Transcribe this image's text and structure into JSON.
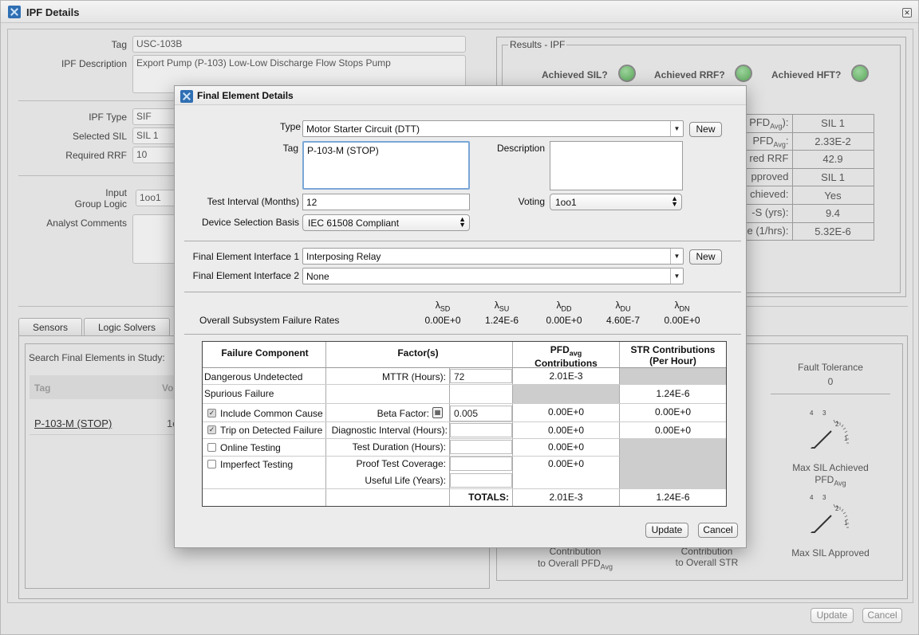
{
  "window": {
    "title": "IPF Details"
  },
  "form": {
    "tag_label": "Tag",
    "tag_value": "USC-103B",
    "desc_label": "IPF Description",
    "desc_value": "Export Pump (P-103) Low-Low Discharge Flow Stops Pump",
    "type_label": "IPF Type",
    "type_value": "SIF",
    "sil_label": "Selected SIL",
    "sil_value": "SIL 1",
    "rrf_label": "Required RRF",
    "rrf_value": "10",
    "input_label": "Input",
    "group_logic_label": "Group Logic",
    "group_logic_value": "1oo1",
    "comments_label": "Analyst Comments"
  },
  "results": {
    "title": "Results - IPF",
    "achieved_sil": "Achieved SIL?",
    "achieved_rrf": "Achieved RRF?",
    "achieved_hft": "Achieved HFT?",
    "rows": [
      {
        "label": "PFD",
        "sub": "Avg",
        "suffix": "):",
        "value": "SIL 1"
      },
      {
        "label": "PFD",
        "sub": "Avg",
        "suffix": ":",
        "value": "2.33E-2"
      },
      {
        "label": "red RRF",
        "sub": "",
        "suffix": "",
        "value": "42.9"
      },
      {
        "label": "pproved",
        "sub": "",
        "suffix": "",
        "value": "SIL 1"
      },
      {
        "label": "chieved:",
        "sub": "",
        "suffix": "",
        "value": "Yes"
      },
      {
        "label": "-S (yrs):",
        "sub": "",
        "suffix": "",
        "value": "9.4"
      },
      {
        "label": "e (1/hrs):",
        "sub": "",
        "suffix": "",
        "value": "5.32E-6"
      }
    ]
  },
  "tabs": [
    "Sensors",
    "Logic Solvers"
  ],
  "final_elements": {
    "search_label": "Search Final Elements in Study:",
    "col_tag": "Tag",
    "col_vo": "Vo",
    "row_tag": "P-103-M (STOP)",
    "row_vo": "1c"
  },
  "right_panel": {
    "fault_tolerance_label": "Fault Tolerance",
    "fault_tolerance_value": "0",
    "gauge1_label": "Max SIL Achieved",
    "gauge1_sub_label": "PFD",
    "gauge1_sub": "Avg",
    "gauge2_label": "Max SIL Approved",
    "contrib_pfd_1": "Contribution",
    "contrib_pfd_2": "to Overall PFD",
    "contrib_pfd_sub": "Avg",
    "contrib_str_1": "Contribution",
    "contrib_str_2": "to Overall STR",
    "gauge_ticks": [
      "4",
      "3",
      "2",
      "1",
      "0"
    ]
  },
  "bottom_buttons": {
    "update": "Update",
    "cancel": "Cancel"
  },
  "modal": {
    "title": "Final Element Details",
    "type_label": "Type",
    "type_value": "Motor Starter Circuit (DTT)",
    "new_label": "New",
    "tag_label": "Tag",
    "tag_value": "P-103-M (STOP)",
    "description_label": "Description",
    "description_value": "",
    "test_interval_label": "Test Interval (Months)",
    "test_interval_value": "12",
    "voting_label": "Voting",
    "voting_value": "1oo1",
    "device_basis_label": "Device Selection Basis",
    "device_basis_value": "IEC 61508 Compliant",
    "interface1_label": "Final Element Interface 1",
    "interface1_value": "Interposing Relay",
    "interface2_label": "Final Element Interface 2",
    "interface2_value": "None",
    "rates_label": "Overall Subsystem Failure Rates",
    "rates": [
      {
        "sym": "λ",
        "sub": "SD",
        "value": "0.00E+0"
      },
      {
        "sym": "λ",
        "sub": "SU",
        "value": "1.24E-6"
      },
      {
        "sym": "λ",
        "sub": "DD",
        "value": "0.00E+0"
      },
      {
        "sym": "λ",
        "sub": "DU",
        "value": "4.60E-7"
      },
      {
        "sym": "λ",
        "sub": "DN",
        "value": "0.00E+0"
      }
    ],
    "table": {
      "h_component": "Failure Component",
      "h_factors": "Factor(s)",
      "h_pfd": "PFD",
      "h_pfd_sub": "avg",
      "h_pfd2": "Contributions",
      "h_str": "STR Contributions",
      "h_str2": "(Per Hour)",
      "r1_comp": "Dangerous Undetected",
      "r1_factor": "MTTR (Hours):",
      "r1_value": "72",
      "r1_pfd": "2.01E-3",
      "r2_comp": "Spurious Failure",
      "r2_str": "1.24E-6",
      "r3_comp": "Include Common Cause",
      "r3_factor": "Beta Factor:",
      "r3_value": "0.005",
      "r3_pfd": "0.00E+0",
      "r3_str": "0.00E+0",
      "r4_comp": "Trip on Detected Failure",
      "r4_factor": "Diagnostic Interval (Hours):",
      "r4_pfd": "0.00E+0",
      "r4_str": "0.00E+0",
      "r5_comp": "Online Testing",
      "r5_factor": "Test Duration (Hours):",
      "r5_pfd": "0.00E+0",
      "r6_comp": "Imperfect Testing",
      "r6_factor": "Proof Test Coverage:",
      "r6_pfd": "0.00E+0",
      "r7_factor": "Useful Life (Years):",
      "totals_label": "TOTALS:",
      "totals_pfd": "2.01E-3",
      "totals_str": "1.24E-6"
    },
    "update_label": "Update",
    "cancel_label": "Cancel"
  },
  "colors": {
    "led_green": "#6bb56b",
    "accent_blue": "#2f6fb3"
  }
}
